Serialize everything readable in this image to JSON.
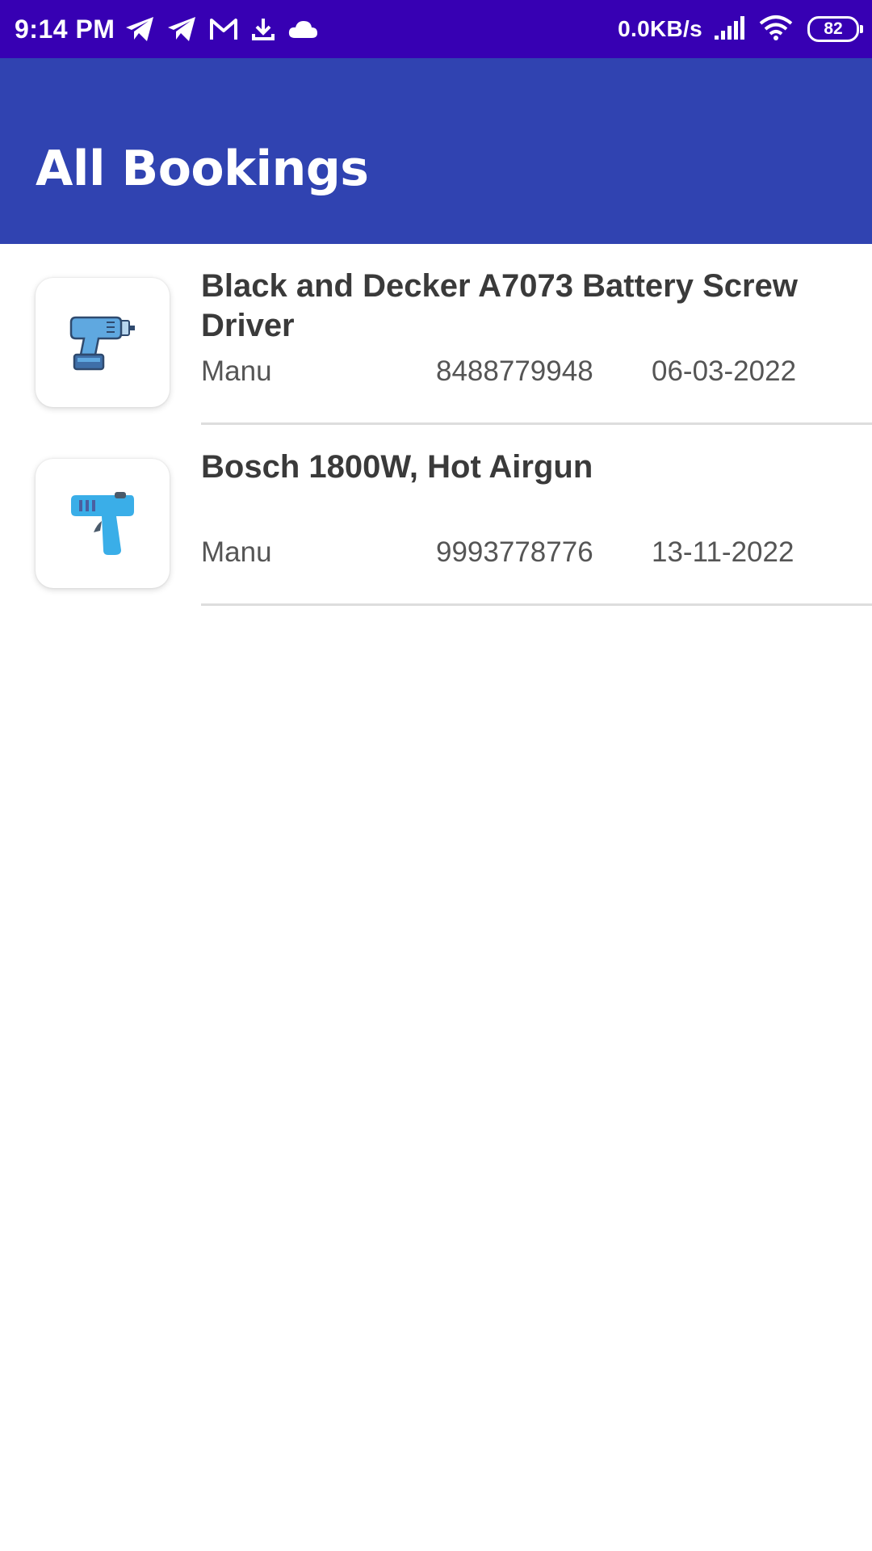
{
  "status_bar": {
    "time": "9:14 PM",
    "net_speed": "0.0KB/s",
    "battery": "82",
    "icons": [
      "telegram-icon",
      "telegram-icon",
      "gmail-icon",
      "download-icon",
      "cloud-icon",
      "signal-icon",
      "wifi-icon",
      "battery-icon"
    ]
  },
  "header": {
    "title": "All Bookings"
  },
  "bookings": [
    {
      "title": "Black and Decker A7073 Battery Screw Driver",
      "name": "Manu",
      "phone": "8488779948",
      "date": "06-03-2022",
      "icon": "cordless-drill-icon"
    },
    {
      "title": "Bosch 1800W, Hot Airgun",
      "name": "Manu",
      "phone": "9993778776",
      "date": "13-11-2022",
      "icon": "hot-air-gun-icon"
    }
  ],
  "colors": {
    "status_bar": "#3700b3",
    "app_bar": "#3043b1",
    "text": "#3a3a3a"
  }
}
